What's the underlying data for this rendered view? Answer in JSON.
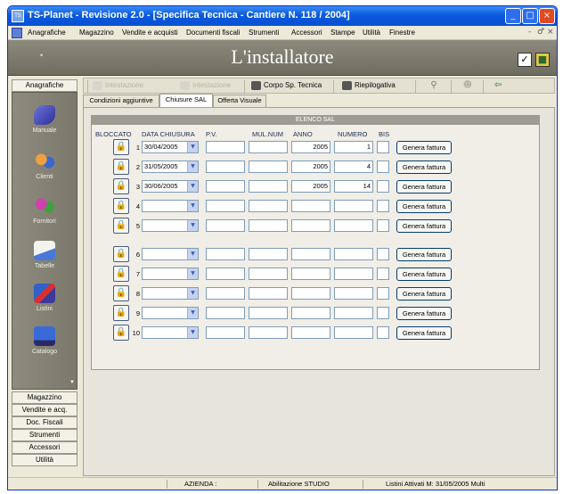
{
  "window": {
    "app_icon_text": "TS",
    "title": "TS-Planet - Revisione 2.0 - [Specifica Tecnica - Cantiere N. 118 / 2004]",
    "controls": {
      "minimize": "_",
      "maximize": "□",
      "close": "×"
    }
  },
  "menubar": {
    "items": [
      "Anagrafiche",
      "Magazzino",
      "Vendite e acquisti",
      "Documenti fiscali",
      "Strumenti",
      "Accessori",
      "Stampe",
      "Utilità",
      "Finestre"
    ],
    "controls": [
      "-",
      "♂",
      "×"
    ]
  },
  "header": {
    "small_label": "•",
    "title": "L'installatore",
    "check_icon": "✓",
    "app_icon": "■"
  },
  "left_tab": "Anagrafiche",
  "sidebar": {
    "items": [
      {
        "label": "Manuale",
        "icon": "manual-icon"
      },
      {
        "label": "Clienti",
        "icon": "clients-icon"
      },
      {
        "label": "Fornitori",
        "icon": "suppliers-icon"
      },
      {
        "label": "Tabelle",
        "icon": "tables-icon"
      },
      {
        "label": "Listini",
        "icon": "price-lists-icon"
      },
      {
        "label": "Catalogo",
        "icon": "catalog-icon"
      }
    ],
    "scroll_indicator": "▼",
    "buttons": [
      "Magazzino",
      "Vendite e acq.",
      "Doc. Fiscali",
      "Strumenti",
      "Accessori",
      "Utilità"
    ]
  },
  "toolbar": {
    "intestazione_1": "Intestazione",
    "intestazione_2": "Intestazione",
    "corpo": "Corpo Sp. Tecnica",
    "riepilogativa": "Riepilogativa",
    "search_icon": "⚲",
    "users_icon": "☻",
    "exit_icon": "⇦"
  },
  "tabs": [
    "Condizioni aggiuntive",
    "Chiusure SAL",
    "Offerta Visuale"
  ],
  "table": {
    "title": "ELENCO SAL",
    "columns": {
      "bloccato": "BLOCCATO",
      "data_chiusura": "DATA CHIUSURA",
      "pv": "P.V.",
      "mul_num": "MUL.NUM",
      "anno": "ANNO",
      "numero": "NUMERO",
      "bis": "BIS"
    },
    "lock_glyph": "🔒",
    "arrow_glyph": "▼",
    "button_label": "Genera fattura",
    "rows": [
      {
        "n": "1",
        "date": "30/04/2005",
        "anno": "2005",
        "numero": "1"
      },
      {
        "n": "2",
        "date": "31/05/2005",
        "anno": "2005",
        "numero": "4"
      },
      {
        "n": "3",
        "date": "30/06/2005",
        "anno": "2005",
        "numero": "14"
      },
      {
        "n": "4",
        "date": "",
        "anno": "",
        "numero": ""
      },
      {
        "n": "5",
        "date": "",
        "anno": "",
        "numero": ""
      },
      {
        "n": "6",
        "date": "",
        "anno": "",
        "numero": ""
      },
      {
        "n": "7",
        "date": "",
        "anno": "",
        "numero": ""
      },
      {
        "n": "8",
        "date": "",
        "anno": "",
        "numero": ""
      },
      {
        "n": "9",
        "date": "",
        "anno": "",
        "numero": ""
      },
      {
        "n": "10",
        "date": "",
        "anno": "",
        "numero": ""
      }
    ]
  },
  "statusbar": {
    "azienda": "AZIENDA :",
    "abilitazione": "Abilitazione STUDIO",
    "listini": "Listini Attivati  M:  31/05/2005  Multi"
  },
  "colors": {
    "titlebar": "#0a5ae0",
    "header_band": "#7e7b6f",
    "sidebar": "#858276",
    "table_header": "#9e9c92"
  }
}
